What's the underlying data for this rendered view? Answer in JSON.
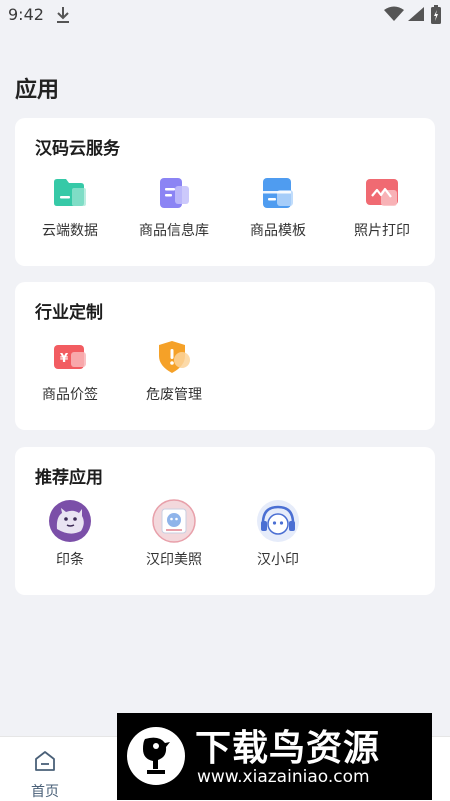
{
  "status_bar": {
    "time": "9:42"
  },
  "page": {
    "title": "应用"
  },
  "sections": [
    {
      "title": "汉码云服务",
      "items": [
        {
          "label": "云端数据",
          "icon": "folder-icon"
        },
        {
          "label": "商品信息库",
          "icon": "document-stack-icon"
        },
        {
          "label": "商品模板",
          "icon": "template-icon"
        },
        {
          "label": "照片打印",
          "icon": "photo-print-icon"
        }
      ]
    },
    {
      "title": "行业定制",
      "items": [
        {
          "label": "商品价签",
          "icon": "price-tag-icon"
        },
        {
          "label": "危废管理",
          "icon": "hazard-shield-icon"
        }
      ]
    },
    {
      "title": "推荐应用",
      "items": [
        {
          "label": "印条",
          "icon": "yintiao-avatar-icon"
        },
        {
          "label": "汉印美照",
          "icon": "meizhao-avatar-icon"
        },
        {
          "label": "汉小印",
          "icon": "hanxiaoyin-avatar-icon"
        }
      ]
    }
  ],
  "tabbar": {
    "home_label": "首页"
  },
  "watermark": {
    "title": "下载鸟资源",
    "url": "www.xiazainiao.com"
  },
  "colors": {
    "background": "#f1f2f6",
    "card": "#ffffff",
    "folder": "#36c9a7",
    "document": "#8b84f4",
    "template": "#4f9cf0",
    "photo": "#f06a72",
    "price_tag": "#f25c61",
    "hazard": "#f5a128",
    "tab_home": "#4a6078"
  }
}
